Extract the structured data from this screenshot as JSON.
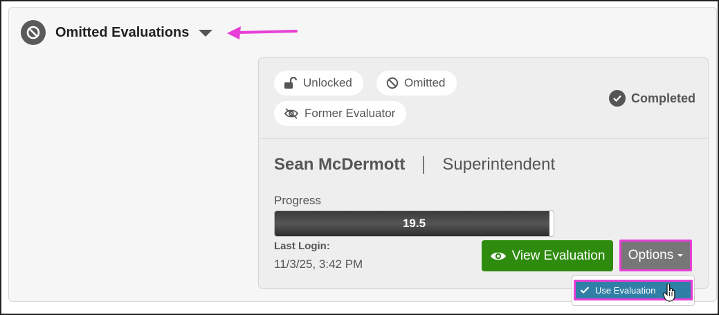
{
  "section": {
    "title": "Omitted Evaluations",
    "icon": "ban-icon",
    "toggle_icon": "caret-down-icon"
  },
  "annotation": {
    "arrow_color": "#e83fd6"
  },
  "card": {
    "tags": [
      {
        "label": "Unlocked",
        "icon": "unlock-icon"
      },
      {
        "label": "Omitted",
        "icon": "ban-icon"
      },
      {
        "label": "Former Evaluator",
        "icon": "eye-slash-icon"
      }
    ],
    "status": {
      "label": "Completed",
      "icon": "check-circle-icon"
    },
    "name": "Sean McDermott",
    "role": "Superintendent",
    "progress": {
      "label": "Progress",
      "value": "19.5",
      "fill_fraction": 0.985
    },
    "last_login": {
      "label": "Last Login:",
      "value": "11/3/25, 3:42 PM"
    },
    "buttons": {
      "view": "View Evaluation",
      "options": "Options"
    },
    "options_menu": {
      "items": [
        {
          "label": "Use Evaluation",
          "icon": "check-icon"
        }
      ]
    }
  },
  "colors": {
    "view_button": "#2e8b0e",
    "options_button": "#777777",
    "menu_item_active": "#2f7fa6",
    "highlight": "#e83fd6"
  }
}
